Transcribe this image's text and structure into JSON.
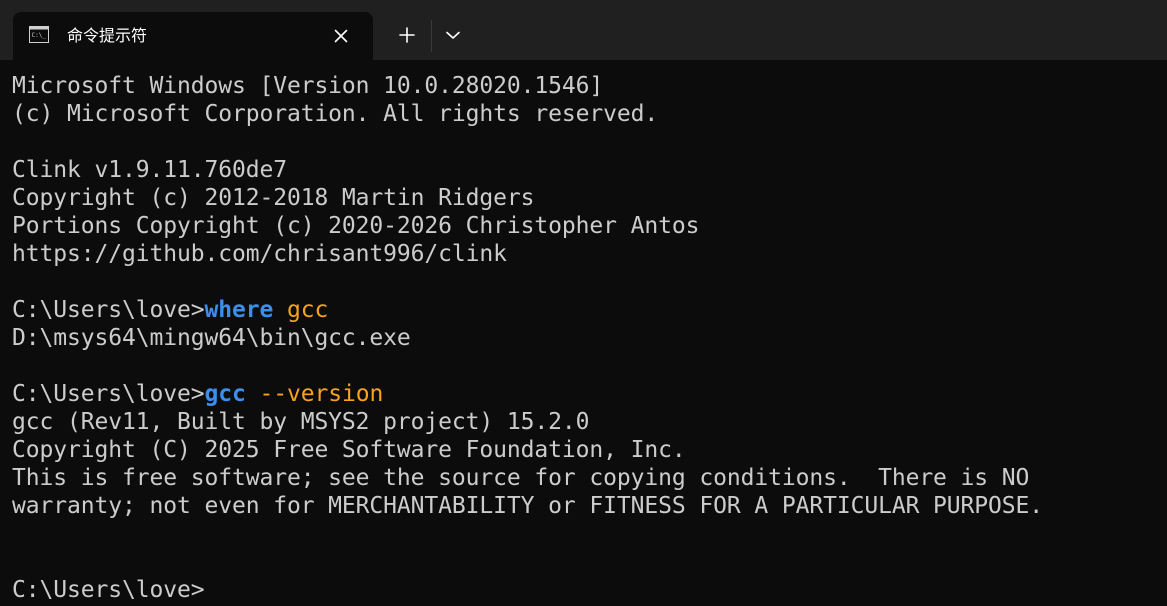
{
  "window": {
    "tab_title": "命令提示符",
    "tab_icon": "console-icon",
    "close_icon": "close-icon",
    "new_tab_icon": "plus-icon",
    "dropdown_icon": "chevron-down-icon"
  },
  "colors": {
    "background": "#0c0c0c",
    "titlebar": "#202020",
    "text": "#cccccc",
    "command": "#3b8eea",
    "argument": "#f7a31b"
  },
  "terminal": {
    "lines": [
      {
        "text": "Microsoft Windows [Version 10.0.28020.1546]"
      },
      {
        "text": "(c) Microsoft Corporation. All rights reserved."
      },
      {
        "text": ""
      },
      {
        "text": "Clink v1.9.11.760de7"
      },
      {
        "text": "Copyright (c) 2012-2018 Martin Ridgers"
      },
      {
        "text": "Portions Copyright (c) 2020-2026 Christopher Antos"
      },
      {
        "text": "https://github.com/chrisant996/clink"
      },
      {
        "text": ""
      },
      {
        "prompt": "C:\\Users\\love>",
        "command": "where",
        "args": " gcc"
      },
      {
        "text": "D:\\msys64\\mingw64\\bin\\gcc.exe"
      },
      {
        "text": ""
      },
      {
        "prompt": "C:\\Users\\love>",
        "command": "gcc",
        "args": " --version"
      },
      {
        "text": "gcc (Rev11, Built by MSYS2 project) 15.2.0"
      },
      {
        "text": "Copyright (C) 2025 Free Software Foundation, Inc."
      },
      {
        "text": "This is free software; see the source for copying conditions.  There is NO"
      },
      {
        "text": "warranty; not even for MERCHANTABILITY or FITNESS FOR A PARTICULAR PURPOSE."
      },
      {
        "text": ""
      },
      {
        "text": ""
      },
      {
        "prompt": "C:\\Users\\love>",
        "command": "",
        "args": ""
      }
    ]
  }
}
